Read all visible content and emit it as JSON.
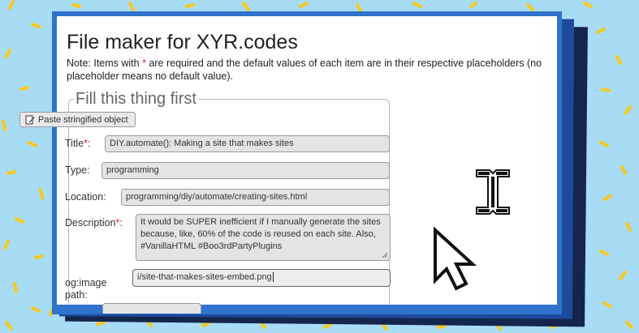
{
  "header": {
    "title": "File maker for XYR.codes",
    "note_prefix": "Note: Items with ",
    "note_star": "*",
    "note_suffix": " are required and the default values of each item are in their respective placeholders (no placeholder means no default value)."
  },
  "form": {
    "legend": "Fill this thing first",
    "paste_label": "Paste stringified object",
    "title_label": "Title",
    "title_value": "DIY.automate(): Making a site that makes sites",
    "type_label": "Type:",
    "type_value": "programming",
    "location_label": "Location:",
    "location_value": "programming/diy/automate/creating-sites.html",
    "description_label": "Description",
    "description_value": "It would be SUPER inefficient if I manually generate the sites because, like, 60% of the code is reused on each site. Also, #VanillaHTML #Boo3rdPartyPlugins",
    "ogimage_label": "og:image path:",
    "ogimage_value": "i/site-that-makes-sites-embed.png",
    "required_marker": "*",
    "colon": ":"
  },
  "icons": [
    "paste-icon",
    "text-cursor-icon",
    "pointer-cursor-icon",
    "resize-handle-icon"
  ],
  "colors": {
    "background": "#a8dcf5",
    "frame_blue": "#2f73cc",
    "frame_mid": "#1d4a9b",
    "frame_navy": "#15264d",
    "required": "#e02020"
  }
}
